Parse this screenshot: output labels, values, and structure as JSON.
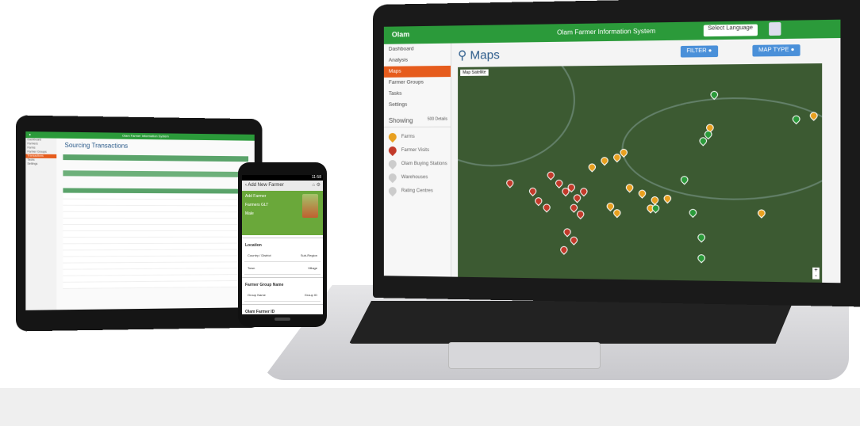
{
  "laptop": {
    "header": {
      "logo": "Olam",
      "title": "Olam Farmer Information System",
      "language": "Select Language"
    },
    "sidebar": {
      "items": [
        {
          "label": "Dashboard"
        },
        {
          "label": "Analysis"
        },
        {
          "label": "Maps",
          "active": true
        },
        {
          "label": "Farmer Groups"
        },
        {
          "label": "Tasks"
        },
        {
          "label": "Settings"
        }
      ],
      "showing_label": "Showing",
      "showing_count": "500 Details",
      "legend": [
        {
          "label": "Farms",
          "color": "#e8a020"
        },
        {
          "label": "Farmer Visits",
          "color": "#c23a2a"
        },
        {
          "label": "Olam Buying Stations",
          "color": "#cccccc"
        },
        {
          "label": "Warehouses",
          "color": "#cccccc"
        },
        {
          "label": "Rating Centres",
          "color": "#cccccc"
        }
      ]
    },
    "main": {
      "title": "Maps",
      "filter_label": "FILTER",
      "maptype_label": "MAP TYPE",
      "map_toggle": "Map  Satellite",
      "zoom_in": "+",
      "zoom_out": "-"
    }
  },
  "tablet": {
    "header_title": "Olam Farmer Information System",
    "page_title": "Sourcing Transactions",
    "sidebar": [
      "Dashboard",
      "Farmers",
      "Farms",
      "Farmer Groups",
      "Transactions",
      "Tasks",
      "Settings"
    ],
    "active_index": 4
  },
  "phone": {
    "status_time": "11:58",
    "appbar_title": "Add New Farmer",
    "profile": {
      "name": "Add Farmer",
      "group": "Farmers GLT",
      "gender": "Male"
    },
    "sections": {
      "location": "Location",
      "farmer_group": "Farmer Group Name",
      "farmer_id": "Olam Farmer ID"
    },
    "fields": [
      {
        "left": "Country / District",
        "right": "Sub-Region"
      },
      {
        "left": "Town",
        "right": "Village"
      },
      {
        "left": "Group Name",
        "right": "Group ID"
      }
    ]
  },
  "colors": {
    "brand_green": "#2b9a3a",
    "active_orange": "#e65c1d",
    "button_blue": "#4a90d9",
    "title_blue": "#2a5a8a"
  }
}
